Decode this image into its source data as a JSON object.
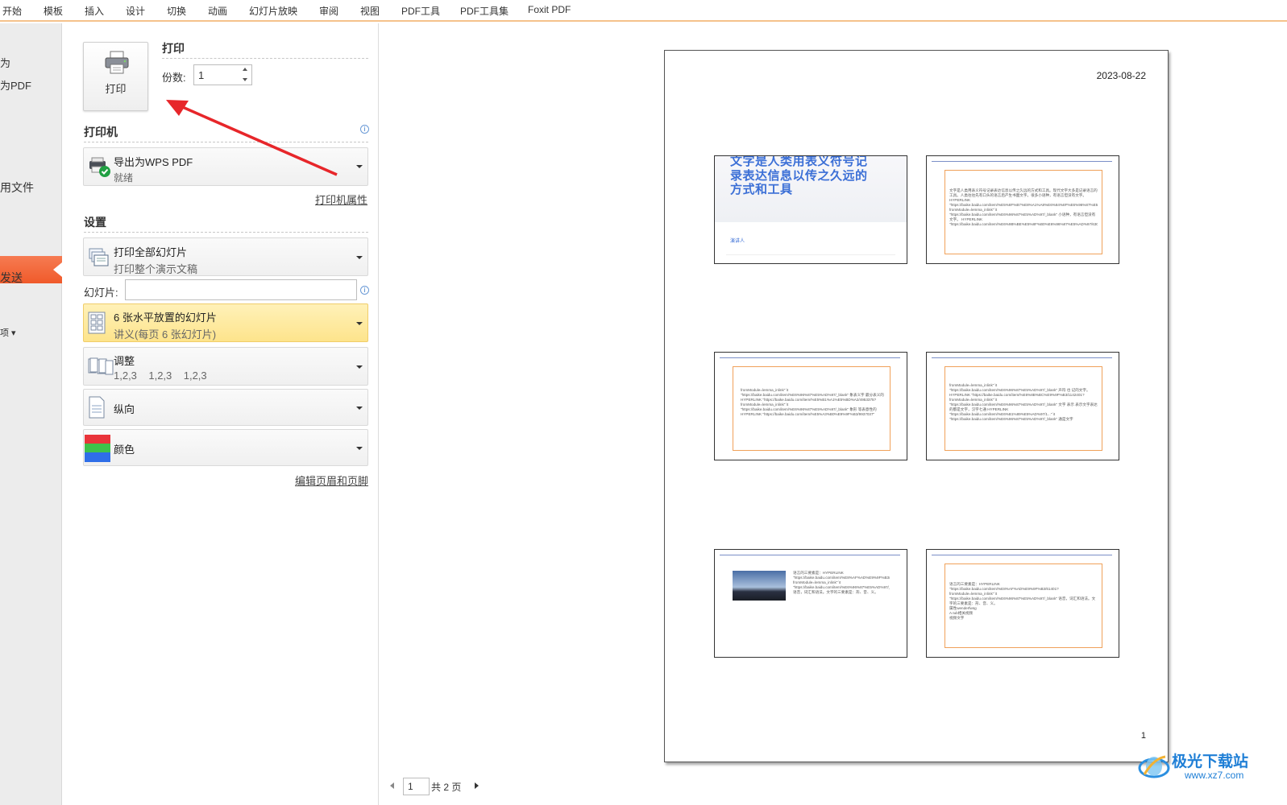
{
  "menu": [
    "开始",
    "模板",
    "插入",
    "设计",
    "切换",
    "动画",
    "幻灯片放映",
    "审阅",
    "视图",
    "PDF工具",
    "PDF工具集",
    "Foxit PDF"
  ],
  "left_nav": {
    "items": [
      "为",
      "为PDF",
      "用文件",
      "发送",
      "项 ▾"
    ]
  },
  "print": {
    "section_title": "打印",
    "print_button_label": "打印",
    "copies_label": "份数:",
    "copies_value": "1"
  },
  "printer": {
    "section_title": "打印机",
    "name": "导出为WPS PDF",
    "status": "就绪",
    "properties_link": "打印机属性"
  },
  "settings": {
    "section_title": "设置",
    "range_title": "打印全部幻灯片",
    "range_sub": "打印整个演示文稿",
    "slides_label": "幻灯片:",
    "slides_value": "",
    "layout_title": "6 张水平放置的幻灯片",
    "layout_sub": "讲义(每页 6 张幻灯片)",
    "collate_title": "调整",
    "collate_sub": "1,2,3    1,2,3    1,2,3",
    "orientation": "纵向",
    "color": "颜色",
    "header_footer_link": "编辑页眉和页脚"
  },
  "preview": {
    "date": "2023-08-22",
    "page_number": "1",
    "nav_page_value": "1",
    "nav_total": "共 2 页",
    "slide1": {
      "title": "文字是人类用表义符号记录表达信息以传之久远的方式和工具",
      "presenter": "演讲人"
    },
    "slide2_text": "文字是人类用表义符号记录表达信息以传之久远的方式和工具。现代文字大多是记录语言的工具。人类往往先有口头的语言后产生书面文字。很多小语种，有语言但没有文字。HYPERLINK \"https://baike.baidu.com/item/%E5%8F%B7%E8%A1%A8%E6%84%8F%E6%96%87%E5%AD%97/1610699?fromModule=lemma_inlink\" \\t \"https://baike.baidu.com/item/%E6%96%87%E5%AD%97/_blank\" 小语种，有语言但没有文字。 HYPERLINK \"https://baike.baidu.com/item/%E6%9B%BE%E5%8F%B0%E6%96%87%E5%AD%97/6307652\"",
    "slide3_text": "fromModule=lemma_inlink\" \\t \"https://baike.baidu.com/item/%E6%96%87%E5%AD%97/_blank\" 象表义字 最分表义的 HYPERLINK \"https://baike.baidu.com/item/%E5%B1%A1%E5%BD%A2/4953375?fromModule=lemma_inlink\" \\t \"https://baike.baidu.com/item/%E6%96%87%E5%AD%97/_blank\" 象形 等表意性的 HYPERLINK \"https://baike.baidu.com/item/%E5%A3%B0%E9%9F%B3/9937037\"",
    "slide4_text": "fromModule=lemma_inlink\" \\t \"https://baike.baidu.com/item/%E6%96%87%E5%AD%97/_blank\" 声符 也 记的文字。 HYPERLINK \"https://baike.baidu.com/item/%E6%8B%BC%E9%9F%B3/1142401?fromModule=lemma_inlink\" \\t \"https://baike.baidu.com/item/%E6%96%87%E5%AD%97/_blank\" 文字 表示 表示文字表达的都是文字，汉字七通 HYPERLINK \"https://baike.baidu.com/item/%E6%B1%89%E5%AD%97/1...\" \\t \"https://baike.baidu.com/item/%E6%96%87%E5%AD%97/_blank\" 通是文字",
    "slide5_text": "语言的三要素是：HYPERLINK \"https://baike.baidu.com/item/%E8%AF%AD%E9%9F%B3/61401?fromModule=lemma_inlink\" \\t \"https://baike.baidu.com/item/%E6%96%87%E5%AD%97/_blank\" 语音，词汇和语法。文字的三要素是：形、音、义。",
    "slide6_text": "语言的三要素是：HYPERLINK \"https://baike.baidu.com/item/%E8%AF%AD%E9%9F%B3/61401?fromModule=lemma_inlink\" \\t \"https://baike.baidu.com/item/%E6%96%87%E5%AD%97/_blank\" 语音，词汇和语法。文字的三要素是：形、音、义。\n属性wenderfwsg\nA.tub相关视频\n视频文字"
  },
  "watermark": {
    "name": "极光下载站",
    "url": "www.xz7.com"
  },
  "colors": {
    "accent_orange": "#f05a2a",
    "highlight_yellow": "#fde99a",
    "slide_title_blue": "#3b6fd6",
    "frame_orange": "#f0a15a"
  }
}
